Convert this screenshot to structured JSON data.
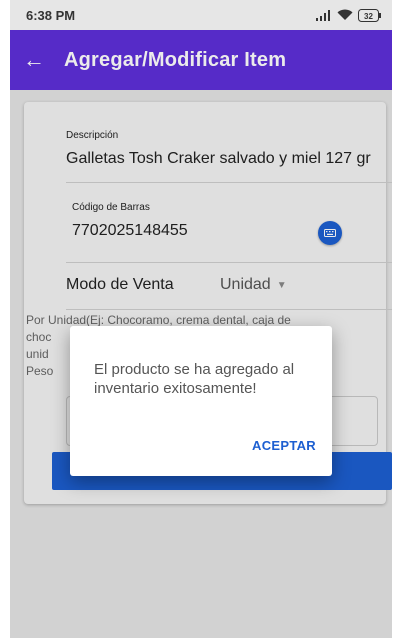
{
  "status_bar": {
    "time": "6:38 PM",
    "battery": "32"
  },
  "app_bar": {
    "title": "Agregar/Modificar Item",
    "back_icon": "arrow-back-icon"
  },
  "form": {
    "description": {
      "label": "Descripción",
      "value": "Galletas Tosh Craker salvado y miel 127 gr"
    },
    "barcode": {
      "label": "Código de Barras",
      "value": "7702025148455",
      "scan_icon": "keyboard-icon"
    },
    "sale_mode": {
      "label": "Modo de Venta",
      "selected": "Unidad"
    },
    "help_lines": [
      "Por Unidad(Ej: Chocoramo, crema dental, caja de",
      "choc",
      "unid",
      "Peso"
    ]
  },
  "dialog": {
    "message": "El producto se ha agregado al inventario exitosamente!",
    "confirm_label": "ACEPTAR"
  },
  "colors": {
    "primary": "#5e2fd9",
    "accent": "#1d5fd1"
  }
}
